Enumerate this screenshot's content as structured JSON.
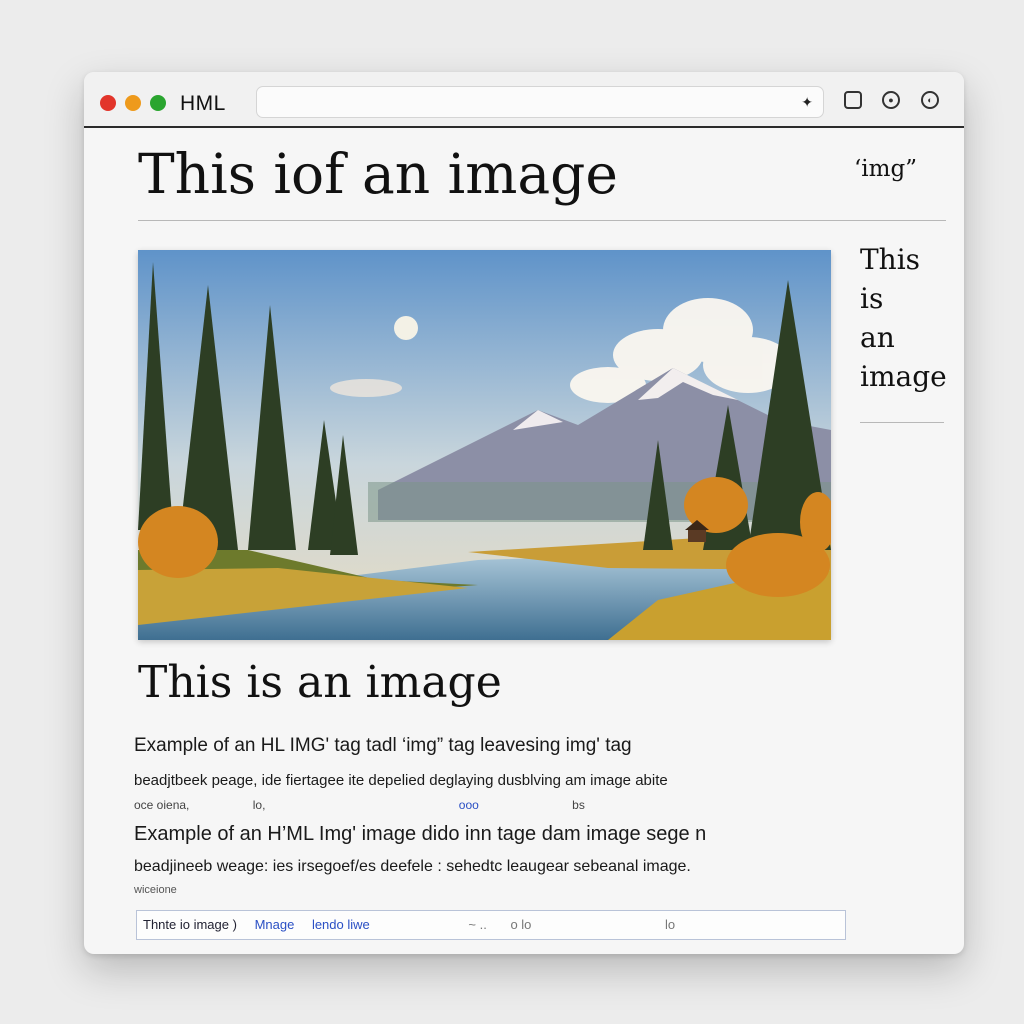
{
  "window": {
    "tab_title": "HML",
    "toolbar_icons": [
      "extension-icon",
      "square-icon",
      "record-icon",
      "profile-icon"
    ]
  },
  "page": {
    "headline": "This iof an image",
    "img_tag_label": "‘img”",
    "side_caption": [
      "This",
      "is",
      "an",
      "image"
    ],
    "subheading": "This is an image",
    "paragraph_lines": [
      "Example of an HL IMG' tag tadl ‘img” tag leavesing img' tag",
      "beadjtbeek peage, ide fiertagee ite depelied deglaying dusblving am image abite",
      "oce oiena,",
      "Example of an H’ML Img' image dido inn tage dam image sege n",
      "beadjineeb weage: ies irsegoef/es deefele : sehedtc leaugear sebeanal image.",
      "wiceione"
    ],
    "line3_extra": [
      "lo,",
      "ooo",
      "bs"
    ],
    "caption_field": [
      "Thnte io image )",
      "Mnage",
      "lendo liwe",
      "~ ..",
      "o lo",
      "lo"
    ]
  },
  "colors": {
    "close": "#e2352b",
    "minimize": "#ee9a1c",
    "maximize": "#2aa52f",
    "link_blue": "#2a4fc4"
  }
}
